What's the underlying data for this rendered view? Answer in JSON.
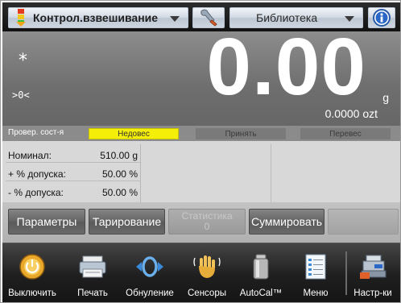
{
  "toolbar": {
    "app_mode_label": "Контрол.взвешивание",
    "library_label": "Библиотека"
  },
  "display": {
    "stable_indicator": "*",
    "center_zero_indicator": ">0<",
    "main_value": "0.00",
    "main_unit": "g",
    "secondary_value": "0.0000 ozt"
  },
  "check_status": {
    "label": "Провер. сост-я",
    "zones": [
      {
        "label": "Недовес",
        "active": true
      },
      {
        "label": "Принять",
        "active": false
      },
      {
        "label": "Перевес",
        "active": false
      }
    ]
  },
  "parameters": [
    {
      "label": "Номинал:",
      "value": "510.00 g"
    },
    {
      "label": "+ % допуска:",
      "value": "50.00 %"
    },
    {
      "label": "- % допуска:",
      "value": "50.00 %"
    }
  ],
  "function_buttons": {
    "params": "Параметры",
    "tare": "Тарирование",
    "stats_title": "Статистика",
    "stats_count": "0",
    "accumulate": "Суммировать"
  },
  "dock": {
    "off": "Выключить",
    "print": "Печать",
    "zero": "Обнуление",
    "sensors": "Сенсоры",
    "autocal": "AutoCal™",
    "menu": "Меню",
    "setup": "Настр-ки"
  },
  "colors": {
    "under_zone": "#f5ee08",
    "display_bg": "#7a7a7a",
    "dock_bg": "#1f1f1f"
  }
}
